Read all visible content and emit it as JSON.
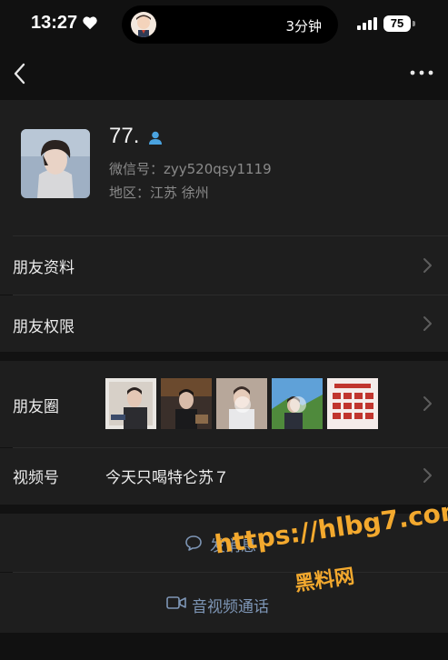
{
  "status_bar": {
    "time": "13:27",
    "island_text": "3分钟",
    "battery": "75"
  },
  "profile": {
    "nickname": "77.",
    "wechat_id": "微信号：zyy520qsy1119",
    "region": "地区：江苏 徐州"
  },
  "rows": {
    "friend_info": "朋友资料",
    "friend_permissions": "朋友权限",
    "moments": "朋友圈",
    "channels": "视频号",
    "channels_name": "今天只喝特仑苏７"
  },
  "actions": {
    "message": "发消息",
    "call": "音视频通话"
  },
  "watermark": {
    "url": "https://hlbg7.com",
    "name": "黑料网"
  },
  "colors": {
    "background": "#111111",
    "card": "#1e1e1e",
    "link_blue": "#7e96b6",
    "watermark": "#f3a92e"
  },
  "icons": [
    "heart-icon",
    "signal-icon",
    "back-icon",
    "more-icon",
    "person-icon",
    "chevron-right-icon",
    "chat-icon",
    "video-call-icon"
  ]
}
